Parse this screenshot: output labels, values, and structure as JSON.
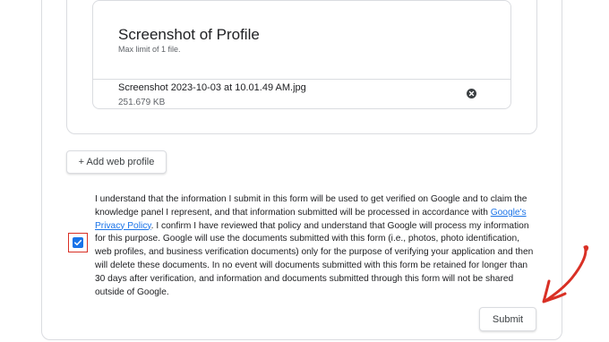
{
  "upload": {
    "title": "Screenshot of Profile",
    "subtitle": "Max limit of 1 file.",
    "file_name": "Screenshot 2023-10-03 at 10.01.49 AM.jpg",
    "file_size": "251.679 KB",
    "remove_icon": "close-circle-icon"
  },
  "add_profile": {
    "label": "+ Add web profile"
  },
  "consent": {
    "checked": true,
    "text_before_link": "I understand that the information I submit in this form will be used to get verified on Google and to claim the knowledge panel I represent, and that information submitted will be processed in accordance with ",
    "link_text": "Google's Privacy Policy",
    "text_after_link": ". I confirm I have reviewed that policy and understand that Google will process my information for this purpose. Google will use the documents submitted with this form (i.e., photos, photo identification, web profiles, and business verification documents) only for the purpose of verifying your application and then will delete these documents. In no event will documents submitted with this form be retained for longer than 30 days after verification, and information and documents submitted through this form will not be shared outside of Google."
  },
  "submit": {
    "label": "Submit"
  },
  "colors": {
    "accent": "#1a73e8",
    "highlight": "#d93025",
    "border": "#dadce0"
  }
}
